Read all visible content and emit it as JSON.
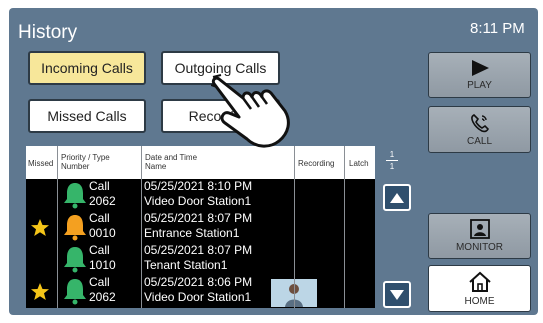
{
  "header": {
    "title": "History",
    "time": "8:11 PM"
  },
  "tabs": [
    {
      "label": "Incoming Calls",
      "active": true
    },
    {
      "label": "Outgoing Calls",
      "active": false
    },
    {
      "label": "Missed Calls",
      "active": false
    },
    {
      "label": "Recording",
      "active": false
    }
  ],
  "right_buttons": {
    "play": "PLAY",
    "call": "CALL",
    "monitor": "MONITOR",
    "home": "HOME"
  },
  "table": {
    "headers": {
      "missed": "Missed",
      "priority_type": "Priority / Type",
      "number": "Number",
      "date_time": "Date and Time",
      "name": "Name",
      "recording": "Recording",
      "latch": "Latch"
    },
    "page": {
      "current": "1",
      "total": "1"
    },
    "rows": [
      {
        "missed": false,
        "priority_color": "#36b56a",
        "type": "Call",
        "number": "2062",
        "datetime": "05/25/2021  8:10 PM",
        "name": "Video Door Station1",
        "recording": false
      },
      {
        "missed": true,
        "priority_color": "#f4a020",
        "type": "Call",
        "number": "0010",
        "datetime": "05/25/2021  8:07 PM",
        "name": "Entrance Station1",
        "recording": false
      },
      {
        "missed": false,
        "priority_color": "#36b56a",
        "type": "Call",
        "number": "1010",
        "datetime": "05/25/2021  8:07 PM",
        "name": "Tenant Station1",
        "recording": false
      },
      {
        "missed": true,
        "priority_color": "#36b56a",
        "type": "Call",
        "number": "2062",
        "datetime": "05/25/2021  8:06 PM",
        "name": "Video Door Station1",
        "recording": true
      }
    ]
  },
  "icons": {
    "play": "play-icon",
    "call": "phone-icon",
    "monitor": "monitor-icon",
    "home": "home-icon",
    "star": "star-icon",
    "bell": "bell-icon",
    "scroll_up": "arrow-up-icon",
    "scroll_down": "arrow-down-icon",
    "pointer": "hand-pointer-icon",
    "thumbnail": "recording-thumbnail"
  },
  "colors": {
    "background": "#5f7890",
    "active_tab": "#f7e79a",
    "star": "#f5c518"
  }
}
